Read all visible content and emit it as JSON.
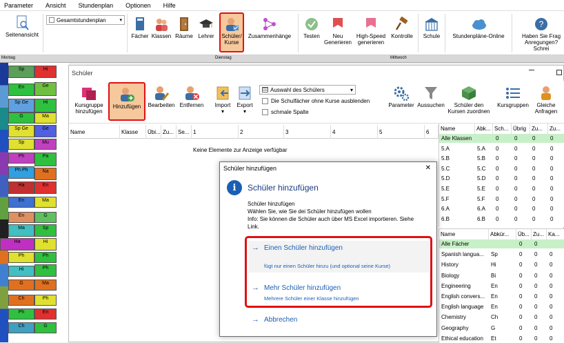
{
  "menubar": {
    "items": [
      "Parameter",
      "Ansicht",
      "Stundenplan",
      "Optionen",
      "Hilfe"
    ]
  },
  "ribbon": {
    "seitenansicht": "Seitenansicht",
    "view_select": "Gesamtstundenplan",
    "faecher": "Fächer",
    "klassen": "Klassen",
    "raeume": "Räume",
    "lehrer": "Lehrer",
    "schueler_kurse_1": "Schüler/",
    "schueler_kurse_2": "Kurse",
    "zusammenhaenge": "Zusammenhänge",
    "testen": "Testen",
    "neu_generieren_1": "Neu",
    "neu_generieren_2": "Generieren",
    "highspeed_1": "High-Speed",
    "highspeed_2": "generieren",
    "kontrolle": "Kontrolle",
    "schule": "Schule",
    "online": "Stundenpläne-Online",
    "help_1": "Haben Sie Frag",
    "help_2": "Anregungen? Schrei"
  },
  "tt_header": [
    "Montag",
    "Dienstag",
    "Mittwoch"
  ],
  "window": {
    "title": "Schüler",
    "ribbon": {
      "kursgruppe_1": "Kursgruppe",
      "kursgruppe_2": "hinzufügen",
      "hinzufuegen": "Hinzufügen",
      "bearbeiten": "Bearbeiten",
      "entfernen": "Entfernen",
      "import": "Import",
      "export": "Export",
      "auswahl": "Auswahl des Schülers",
      "check1": "Die Schulfächer ohne Kurse ausblenden",
      "check2": "schmale Spalte",
      "parameter": "Parameter",
      "aussuchen": "Aussuchen",
      "zuordnen_1": "Schüler den",
      "zuordnen_2": "Kursen zuordnen",
      "kursgruppen": "Kursgruppen",
      "gleiche_1": "Gleiche",
      "gleiche_2": "Anfragen"
    },
    "table_headers": [
      "Name",
      "Klasse",
      "Übi...",
      "Zu...",
      "Se...",
      "1",
      "2",
      "3",
      "4",
      "5",
      "6"
    ],
    "empty_text": "Keine Elemente zur Anzeige verfügbar",
    "classes_panel": {
      "headers": [
        "Name",
        "Abk...",
        "Sch...",
        "Übrig",
        "Zu...",
        "Zu..."
      ],
      "rows": [
        {
          "name": "Alle Klassen",
          "abk": "",
          "a": "0",
          "b": "0",
          "c": "0",
          "d": "0"
        },
        {
          "name": "5.A",
          "abk": "5.A",
          "a": "0",
          "b": "0",
          "c": "0",
          "d": "0"
        },
        {
          "name": "5.B",
          "abk": "5.B",
          "a": "0",
          "b": "0",
          "c": "0",
          "d": "0"
        },
        {
          "name": "5.C",
          "abk": "5.C",
          "a": "0",
          "b": "0",
          "c": "0",
          "d": "0"
        },
        {
          "name": "5.D",
          "abk": "5.D",
          "a": "0",
          "b": "0",
          "c": "0",
          "d": "0"
        },
        {
          "name": "5.E",
          "abk": "5.E",
          "a": "0",
          "b": "0",
          "c": "0",
          "d": "0"
        },
        {
          "name": "5.F",
          "abk": "5.F",
          "a": "0",
          "b": "0",
          "c": "0",
          "d": "0"
        },
        {
          "name": "6.A",
          "abk": "6.A",
          "a": "0",
          "b": "0",
          "c": "0",
          "d": "0"
        },
        {
          "name": "6.B",
          "abk": "6.B",
          "a": "0",
          "b": "0",
          "c": "0",
          "d": "0"
        }
      ]
    },
    "subjects_panel": {
      "headers": [
        "Name",
        "Abkür...",
        "Üb...",
        "Zu...",
        "Ka..."
      ],
      "rows": [
        {
          "name": "Alle Fächer",
          "abk": "",
          "a": "0",
          "b": "0",
          "c": ""
        },
        {
          "name": "Spanish langua...",
          "abk": "Sp",
          "a": "0",
          "b": "0",
          "c": "0"
        },
        {
          "name": "History",
          "abk": "Hi",
          "a": "0",
          "b": "0",
          "c": "0"
        },
        {
          "name": "Biology",
          "abk": "Bi",
          "a": "0",
          "b": "0",
          "c": "0"
        },
        {
          "name": "Engineering",
          "abk": "En",
          "a": "0",
          "b": "0",
          "c": "0"
        },
        {
          "name": "English convers...",
          "abk": "En",
          "a": "0",
          "b": "0",
          "c": "0"
        },
        {
          "name": "English language",
          "abk": "En",
          "a": "0",
          "b": "0",
          "c": "0"
        },
        {
          "name": "Chemistry",
          "abk": "Ch",
          "a": "0",
          "b": "0",
          "c": "0"
        },
        {
          "name": "Geography",
          "abk": "G",
          "a": "0",
          "b": "0",
          "c": "0"
        },
        {
          "name": "Ethical education",
          "abk": "Et",
          "a": "0",
          "b": "0",
          "c": "0"
        }
      ]
    }
  },
  "dialog": {
    "title": "Schüler hinzufügen",
    "heading": "Schüler hinzufügen",
    "sub": "Schüler hinzufügen",
    "text1": "Wählen Sie, wie Sie dei Schüler hinzufügen wollen",
    "text2": "Info: Sie können die Schüler auch über MS Excel importieren. Siehe",
    "text3": "Link.",
    "opt1_title": "Einen Schüler hinzufügen",
    "opt1_desc": "fügt nur einen Schüler hinzu (und optional seine Kurse)",
    "opt2_title": "Mehr Schüler hinzufügen",
    "opt2_desc": "Mehrere Schüler einer Klasse hinzufügen",
    "cancel": "Abbrechen",
    "close": "✕",
    "arrow": "→",
    "info_icon": "i"
  },
  "colors": {
    "accent": "#1a5fb4",
    "highlight": "#e01010",
    "green_row": "#c8f0c8"
  }
}
